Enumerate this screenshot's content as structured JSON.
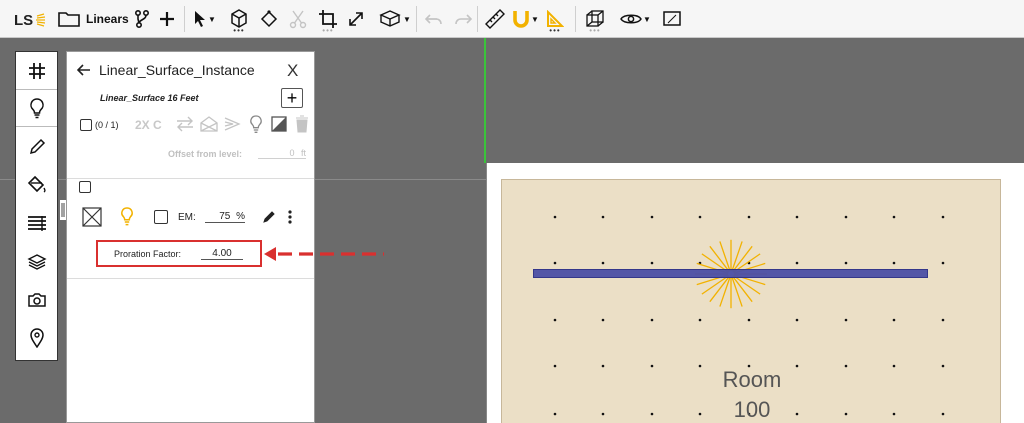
{
  "toolbar": {
    "logo": "LS",
    "linears_label": "Linears"
  },
  "icon_column": {
    "items": [
      "grid-icon",
      "lightbulb-icon",
      "pencil-icon",
      "paint-bucket-icon",
      "rows-icon",
      "layers-icon",
      "camera-icon",
      "location-pin-icon"
    ]
  },
  "panel": {
    "title": "Linear_Surface_Instance",
    "close": "X",
    "subtitle": "Linear_Surface 16 Feet",
    "add": "+",
    "selection_count": "(0 / 1)",
    "twox_c": "2X C",
    "offset_label": "Offset from level:",
    "offset_value": "0",
    "offset_unit": "ft",
    "em_label": "EM:",
    "em_value": "75",
    "em_unit": "%",
    "proration_label": "Proration Factor:",
    "proration_value": "4.00"
  },
  "room": {
    "label_line1": "Room",
    "label_line2": "100"
  },
  "colors": {
    "accent_yellow": "#f2b200",
    "highlight_red": "#d9302f",
    "fixture_blue": "#4b4fa6",
    "room_fill": "#ebdfc6",
    "guide_green": "#3ac43a"
  }
}
